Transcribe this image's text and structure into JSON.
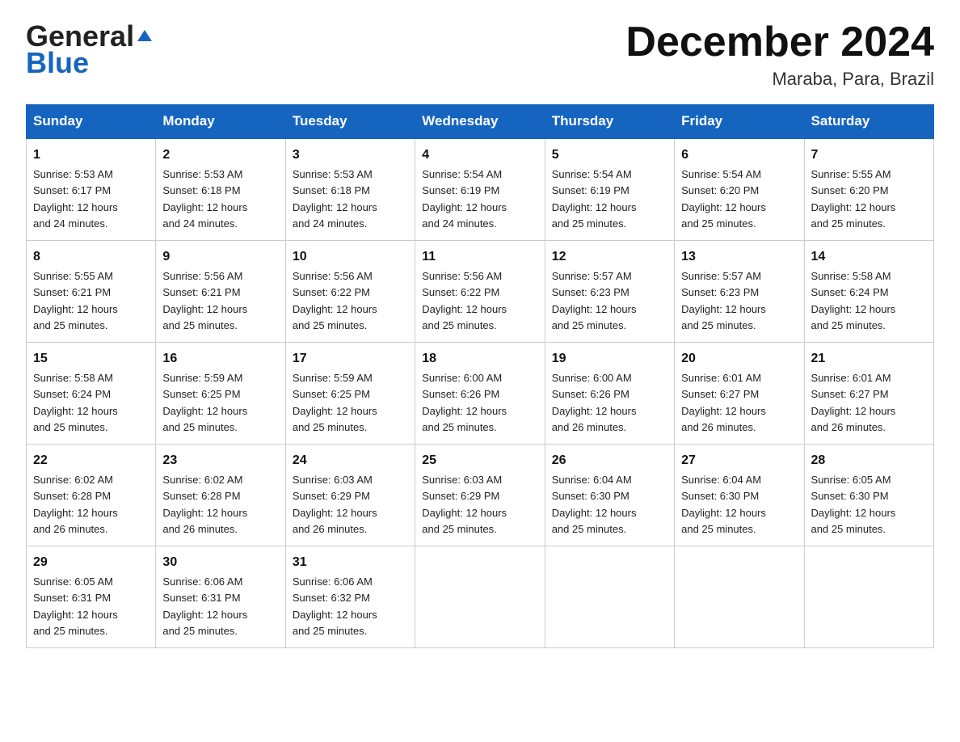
{
  "header": {
    "logo_general": "General",
    "logo_blue": "Blue",
    "month_title": "December 2024",
    "location": "Maraba, Para, Brazil"
  },
  "days_of_week": [
    "Sunday",
    "Monday",
    "Tuesday",
    "Wednesday",
    "Thursday",
    "Friday",
    "Saturday"
  ],
  "weeks": [
    [
      {
        "day": "1",
        "sunrise": "5:53 AM",
        "sunset": "6:17 PM",
        "daylight": "12 hours and 24 minutes."
      },
      {
        "day": "2",
        "sunrise": "5:53 AM",
        "sunset": "6:18 PM",
        "daylight": "12 hours and 24 minutes."
      },
      {
        "day": "3",
        "sunrise": "5:53 AM",
        "sunset": "6:18 PM",
        "daylight": "12 hours and 24 minutes."
      },
      {
        "day": "4",
        "sunrise": "5:54 AM",
        "sunset": "6:19 PM",
        "daylight": "12 hours and 24 minutes."
      },
      {
        "day": "5",
        "sunrise": "5:54 AM",
        "sunset": "6:19 PM",
        "daylight": "12 hours and 25 minutes."
      },
      {
        "day": "6",
        "sunrise": "5:54 AM",
        "sunset": "6:20 PM",
        "daylight": "12 hours and 25 minutes."
      },
      {
        "day": "7",
        "sunrise": "5:55 AM",
        "sunset": "6:20 PM",
        "daylight": "12 hours and 25 minutes."
      }
    ],
    [
      {
        "day": "8",
        "sunrise": "5:55 AM",
        "sunset": "6:21 PM",
        "daylight": "12 hours and 25 minutes."
      },
      {
        "day": "9",
        "sunrise": "5:56 AM",
        "sunset": "6:21 PM",
        "daylight": "12 hours and 25 minutes."
      },
      {
        "day": "10",
        "sunrise": "5:56 AM",
        "sunset": "6:22 PM",
        "daylight": "12 hours and 25 minutes."
      },
      {
        "day": "11",
        "sunrise": "5:56 AM",
        "sunset": "6:22 PM",
        "daylight": "12 hours and 25 minutes."
      },
      {
        "day": "12",
        "sunrise": "5:57 AM",
        "sunset": "6:23 PM",
        "daylight": "12 hours and 25 minutes."
      },
      {
        "day": "13",
        "sunrise": "5:57 AM",
        "sunset": "6:23 PM",
        "daylight": "12 hours and 25 minutes."
      },
      {
        "day": "14",
        "sunrise": "5:58 AM",
        "sunset": "6:24 PM",
        "daylight": "12 hours and 25 minutes."
      }
    ],
    [
      {
        "day": "15",
        "sunrise": "5:58 AM",
        "sunset": "6:24 PM",
        "daylight": "12 hours and 25 minutes."
      },
      {
        "day": "16",
        "sunrise": "5:59 AM",
        "sunset": "6:25 PM",
        "daylight": "12 hours and 25 minutes."
      },
      {
        "day": "17",
        "sunrise": "5:59 AM",
        "sunset": "6:25 PM",
        "daylight": "12 hours and 25 minutes."
      },
      {
        "day": "18",
        "sunrise": "6:00 AM",
        "sunset": "6:26 PM",
        "daylight": "12 hours and 25 minutes."
      },
      {
        "day": "19",
        "sunrise": "6:00 AM",
        "sunset": "6:26 PM",
        "daylight": "12 hours and 26 minutes."
      },
      {
        "day": "20",
        "sunrise": "6:01 AM",
        "sunset": "6:27 PM",
        "daylight": "12 hours and 26 minutes."
      },
      {
        "day": "21",
        "sunrise": "6:01 AM",
        "sunset": "6:27 PM",
        "daylight": "12 hours and 26 minutes."
      }
    ],
    [
      {
        "day": "22",
        "sunrise": "6:02 AM",
        "sunset": "6:28 PM",
        "daylight": "12 hours and 26 minutes."
      },
      {
        "day": "23",
        "sunrise": "6:02 AM",
        "sunset": "6:28 PM",
        "daylight": "12 hours and 26 minutes."
      },
      {
        "day": "24",
        "sunrise": "6:03 AM",
        "sunset": "6:29 PM",
        "daylight": "12 hours and 26 minutes."
      },
      {
        "day": "25",
        "sunrise": "6:03 AM",
        "sunset": "6:29 PM",
        "daylight": "12 hours and 25 minutes."
      },
      {
        "day": "26",
        "sunrise": "6:04 AM",
        "sunset": "6:30 PM",
        "daylight": "12 hours and 25 minutes."
      },
      {
        "day": "27",
        "sunrise": "6:04 AM",
        "sunset": "6:30 PM",
        "daylight": "12 hours and 25 minutes."
      },
      {
        "day": "28",
        "sunrise": "6:05 AM",
        "sunset": "6:30 PM",
        "daylight": "12 hours and 25 minutes."
      }
    ],
    [
      {
        "day": "29",
        "sunrise": "6:05 AM",
        "sunset": "6:31 PM",
        "daylight": "12 hours and 25 minutes."
      },
      {
        "day": "30",
        "sunrise": "6:06 AM",
        "sunset": "6:31 PM",
        "daylight": "12 hours and 25 minutes."
      },
      {
        "day": "31",
        "sunrise": "6:06 AM",
        "sunset": "6:32 PM",
        "daylight": "12 hours and 25 minutes."
      },
      null,
      null,
      null,
      null
    ]
  ],
  "labels": {
    "sunrise": "Sunrise:",
    "sunset": "Sunset:",
    "daylight": "Daylight:"
  }
}
